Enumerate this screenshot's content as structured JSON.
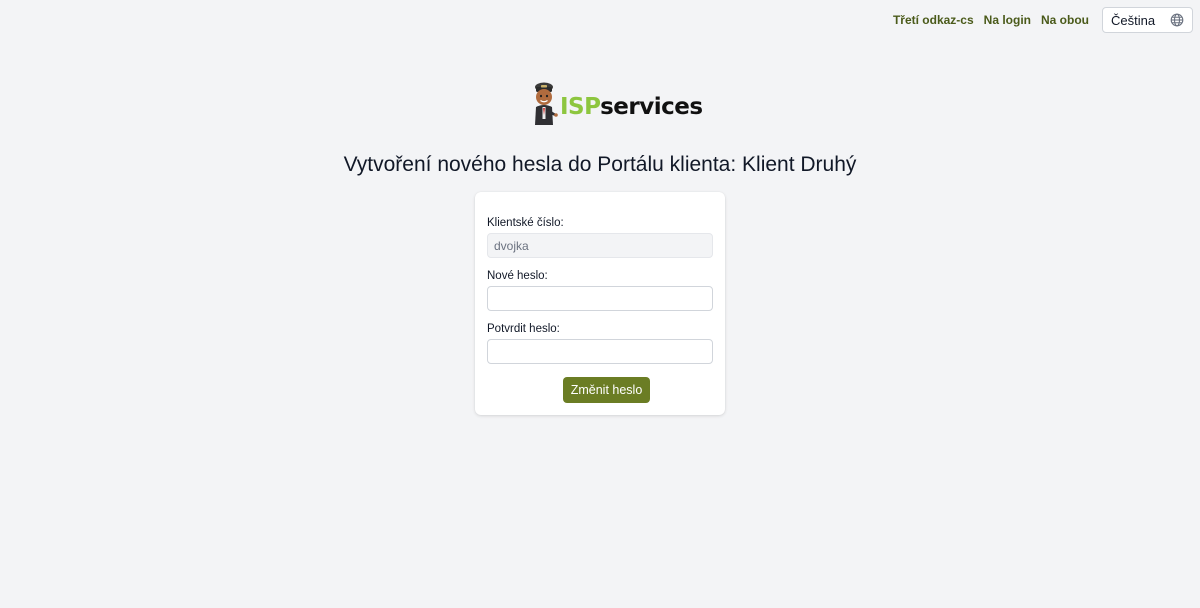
{
  "topbar": {
    "links": [
      "Třetí odkaz-cs",
      "Na login",
      "Na obou"
    ],
    "language": {
      "selected": "Čeština",
      "icon": "globe-icon"
    }
  },
  "logo": {
    "part1": "ISP",
    "part2": "services"
  },
  "page": {
    "title": "Vytvoření nového hesla do Portálu klienta: Klient Druhý"
  },
  "form": {
    "client_number_label": "Klientské číslo:",
    "client_number_value": "dvojka",
    "new_password_label": "Nové heslo:",
    "new_password_value": "",
    "confirm_password_label": "Potvrdit heslo:",
    "confirm_password_value": "",
    "submit_label": "Změnit heslo"
  },
  "colors": {
    "accent": "#6b7d24",
    "link": "#4a5a1a",
    "logo_green": "#8dc63f",
    "background": "#f3f4f6"
  }
}
